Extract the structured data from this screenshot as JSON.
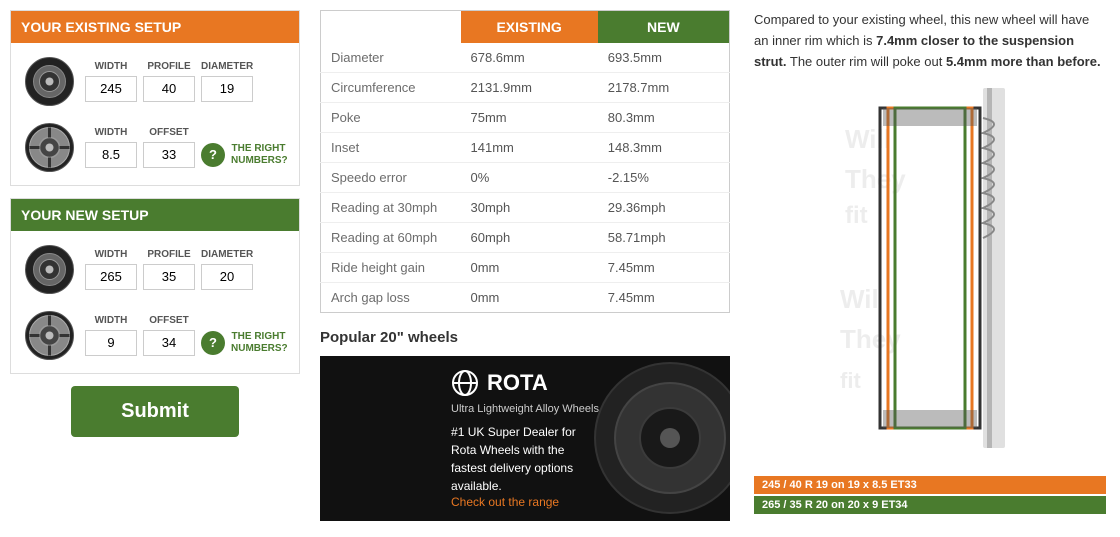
{
  "leftPanel": {
    "existingSetup": {
      "header": "YOUR EXISTING SETUP",
      "row1": {
        "widthLabel": "WIDTH",
        "profileLabel": "PROFILE",
        "diameterLabel": "DIAMETER",
        "width": "245",
        "profile": "40",
        "diameter": "19"
      },
      "row2": {
        "widthLabel": "WIDTH",
        "offsetLabel": "OFFSET",
        "width": "8.5",
        "offset": "33",
        "helpIcon": "?",
        "rightNumbersLink": "THE RIGHT NUMBERS?"
      }
    },
    "newSetup": {
      "header": "YOUR NEW SETUP",
      "row1": {
        "widthLabel": "WIDTH",
        "profileLabel": "PROFILE",
        "diameterLabel": "DIAMETER",
        "width": "265",
        "profile": "35",
        "diameter": "20"
      },
      "row2": {
        "widthLabel": "WIDTH",
        "offsetLabel": "OFFSET",
        "width": "9",
        "offset": "34",
        "helpIcon": "?",
        "rightNumbersLink": "THE RIGHT NUMBERS?"
      }
    },
    "submitLabel": "Submit"
  },
  "comparisonTable": {
    "headers": {
      "label": "",
      "existing": "EXISTING",
      "new": "NEW"
    },
    "rows": [
      {
        "label": "Diameter",
        "existing": "678.6mm",
        "new": "693.5mm"
      },
      {
        "label": "Circumference",
        "existing": "2131.9mm",
        "new": "2178.7mm"
      },
      {
        "label": "Poke",
        "existing": "75mm",
        "new": "80.3mm"
      },
      {
        "label": "Inset",
        "existing": "141mm",
        "new": "148.3mm"
      },
      {
        "label": "Speedo error",
        "existing": "0%",
        "new": "-2.15%"
      },
      {
        "label": "Reading at 30mph",
        "existing": "30mph",
        "new": "29.36mph"
      },
      {
        "label": "Reading at 60mph",
        "existing": "60mph",
        "new": "58.71mph"
      },
      {
        "label": "Ride height gain",
        "existing": "0mm",
        "new": "7.45mm"
      },
      {
        "label": "Arch gap loss",
        "existing": "0mm",
        "new": "7.45mm"
      }
    ]
  },
  "popularSection": {
    "title": "Popular 20\" wheels",
    "ad": {
      "logoText": "ROTA",
      "subtitle": "Ultra Lightweight Alloy Wheels",
      "line1": "#1 UK Super Dealer for",
      "line2": "Rota Wheels with the",
      "line3": "fastest delivery options",
      "line4": "available.",
      "linkText": "Check out the range"
    }
  },
  "rightPanel": {
    "infoText1": "Compared to your existing wheel, this new wheel will have an inner rim which is ",
    "infoHighlight1": "7.4mm closer to the suspension strut.",
    "infoText2": " The outer rim will poke out ",
    "infoHighlight2": "5.4mm more than before.",
    "labels": {
      "existing": "245 / 40 R 19 on 19 x 8.5 ET33",
      "new": "265 / 35 R 20 on 20 x 9 ET34"
    }
  }
}
